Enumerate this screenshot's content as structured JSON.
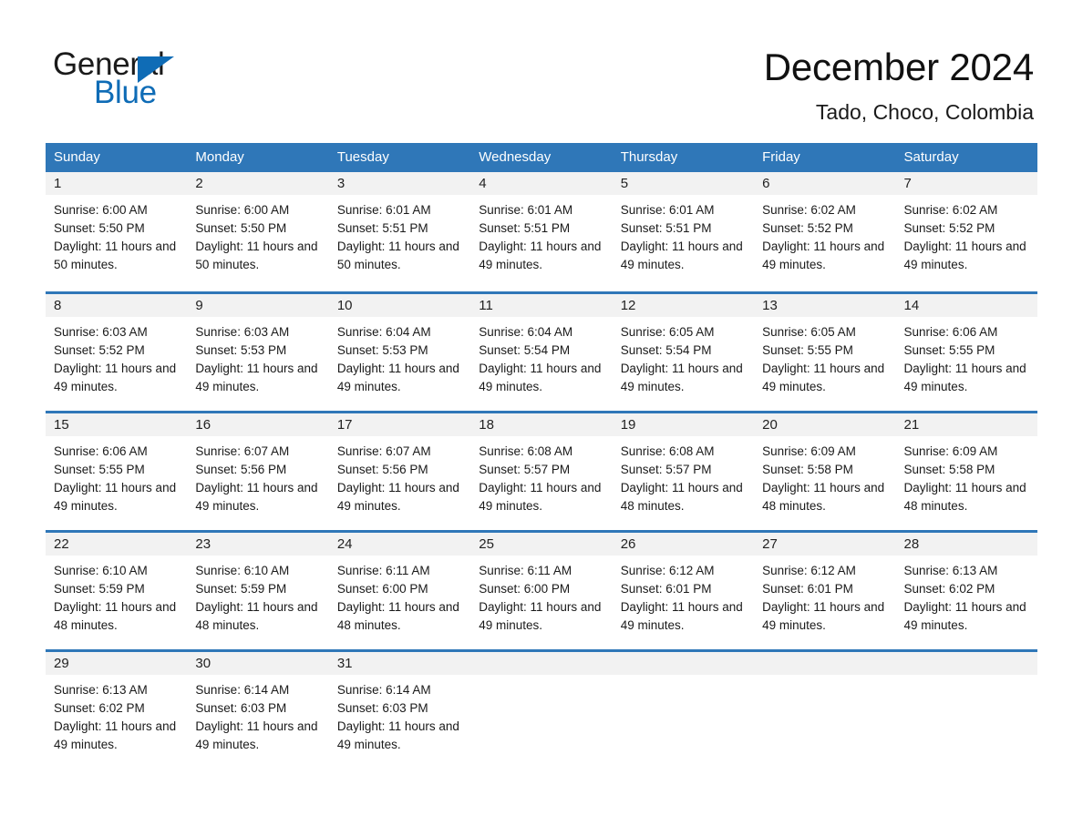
{
  "brand": {
    "name_part1": "General",
    "name_part2": "Blue",
    "triangle_icon": "brand-triangle-icon",
    "accent_color": "#0f6cb6"
  },
  "header": {
    "title": "December 2024",
    "subtitle": "Tado, Choco, Colombia"
  },
  "theme": {
    "header_blue": "#2f77b8",
    "day_bar_gray": "#f2f2f2",
    "text_dark": "#1a1a1a"
  },
  "weekdays": [
    "Sunday",
    "Monday",
    "Tuesday",
    "Wednesday",
    "Thursday",
    "Friday",
    "Saturday"
  ],
  "weeks": [
    [
      {
        "day": "1",
        "sunrise": "Sunrise: 6:00 AM",
        "sunset": "Sunset: 5:50 PM",
        "daylight": "Daylight: 11 hours and 50 minutes."
      },
      {
        "day": "2",
        "sunrise": "Sunrise: 6:00 AM",
        "sunset": "Sunset: 5:50 PM",
        "daylight": "Daylight: 11 hours and 50 minutes."
      },
      {
        "day": "3",
        "sunrise": "Sunrise: 6:01 AM",
        "sunset": "Sunset: 5:51 PM",
        "daylight": "Daylight: 11 hours and 50 minutes."
      },
      {
        "day": "4",
        "sunrise": "Sunrise: 6:01 AM",
        "sunset": "Sunset: 5:51 PM",
        "daylight": "Daylight: 11 hours and 49 minutes."
      },
      {
        "day": "5",
        "sunrise": "Sunrise: 6:01 AM",
        "sunset": "Sunset: 5:51 PM",
        "daylight": "Daylight: 11 hours and 49 minutes."
      },
      {
        "day": "6",
        "sunrise": "Sunrise: 6:02 AM",
        "sunset": "Sunset: 5:52 PM",
        "daylight": "Daylight: 11 hours and 49 minutes."
      },
      {
        "day": "7",
        "sunrise": "Sunrise: 6:02 AM",
        "sunset": "Sunset: 5:52 PM",
        "daylight": "Daylight: 11 hours and 49 minutes."
      }
    ],
    [
      {
        "day": "8",
        "sunrise": "Sunrise: 6:03 AM",
        "sunset": "Sunset: 5:52 PM",
        "daylight": "Daylight: 11 hours and 49 minutes."
      },
      {
        "day": "9",
        "sunrise": "Sunrise: 6:03 AM",
        "sunset": "Sunset: 5:53 PM",
        "daylight": "Daylight: 11 hours and 49 minutes."
      },
      {
        "day": "10",
        "sunrise": "Sunrise: 6:04 AM",
        "sunset": "Sunset: 5:53 PM",
        "daylight": "Daylight: 11 hours and 49 minutes."
      },
      {
        "day": "11",
        "sunrise": "Sunrise: 6:04 AM",
        "sunset": "Sunset: 5:54 PM",
        "daylight": "Daylight: 11 hours and 49 minutes."
      },
      {
        "day": "12",
        "sunrise": "Sunrise: 6:05 AM",
        "sunset": "Sunset: 5:54 PM",
        "daylight": "Daylight: 11 hours and 49 minutes."
      },
      {
        "day": "13",
        "sunrise": "Sunrise: 6:05 AM",
        "sunset": "Sunset: 5:55 PM",
        "daylight": "Daylight: 11 hours and 49 minutes."
      },
      {
        "day": "14",
        "sunrise": "Sunrise: 6:06 AM",
        "sunset": "Sunset: 5:55 PM",
        "daylight": "Daylight: 11 hours and 49 minutes."
      }
    ],
    [
      {
        "day": "15",
        "sunrise": "Sunrise: 6:06 AM",
        "sunset": "Sunset: 5:55 PM",
        "daylight": "Daylight: 11 hours and 49 minutes."
      },
      {
        "day": "16",
        "sunrise": "Sunrise: 6:07 AM",
        "sunset": "Sunset: 5:56 PM",
        "daylight": "Daylight: 11 hours and 49 minutes."
      },
      {
        "day": "17",
        "sunrise": "Sunrise: 6:07 AM",
        "sunset": "Sunset: 5:56 PM",
        "daylight": "Daylight: 11 hours and 49 minutes."
      },
      {
        "day": "18",
        "sunrise": "Sunrise: 6:08 AM",
        "sunset": "Sunset: 5:57 PM",
        "daylight": "Daylight: 11 hours and 49 minutes."
      },
      {
        "day": "19",
        "sunrise": "Sunrise: 6:08 AM",
        "sunset": "Sunset: 5:57 PM",
        "daylight": "Daylight: 11 hours and 48 minutes."
      },
      {
        "day": "20",
        "sunrise": "Sunrise: 6:09 AM",
        "sunset": "Sunset: 5:58 PM",
        "daylight": "Daylight: 11 hours and 48 minutes."
      },
      {
        "day": "21",
        "sunrise": "Sunrise: 6:09 AM",
        "sunset": "Sunset: 5:58 PM",
        "daylight": "Daylight: 11 hours and 48 minutes."
      }
    ],
    [
      {
        "day": "22",
        "sunrise": "Sunrise: 6:10 AM",
        "sunset": "Sunset: 5:59 PM",
        "daylight": "Daylight: 11 hours and 48 minutes."
      },
      {
        "day": "23",
        "sunrise": "Sunrise: 6:10 AM",
        "sunset": "Sunset: 5:59 PM",
        "daylight": "Daylight: 11 hours and 48 minutes."
      },
      {
        "day": "24",
        "sunrise": "Sunrise: 6:11 AM",
        "sunset": "Sunset: 6:00 PM",
        "daylight": "Daylight: 11 hours and 48 minutes."
      },
      {
        "day": "25",
        "sunrise": "Sunrise: 6:11 AM",
        "sunset": "Sunset: 6:00 PM",
        "daylight": "Daylight: 11 hours and 49 minutes."
      },
      {
        "day": "26",
        "sunrise": "Sunrise: 6:12 AM",
        "sunset": "Sunset: 6:01 PM",
        "daylight": "Daylight: 11 hours and 49 minutes."
      },
      {
        "day": "27",
        "sunrise": "Sunrise: 6:12 AM",
        "sunset": "Sunset: 6:01 PM",
        "daylight": "Daylight: 11 hours and 49 minutes."
      },
      {
        "day": "28",
        "sunrise": "Sunrise: 6:13 AM",
        "sunset": "Sunset: 6:02 PM",
        "daylight": "Daylight: 11 hours and 49 minutes."
      }
    ],
    [
      {
        "day": "29",
        "sunrise": "Sunrise: 6:13 AM",
        "sunset": "Sunset: 6:02 PM",
        "daylight": "Daylight: 11 hours and 49 minutes."
      },
      {
        "day": "30",
        "sunrise": "Sunrise: 6:14 AM",
        "sunset": "Sunset: 6:03 PM",
        "daylight": "Daylight: 11 hours and 49 minutes."
      },
      {
        "day": "31",
        "sunrise": "Sunrise: 6:14 AM",
        "sunset": "Sunset: 6:03 PM",
        "daylight": "Daylight: 11 hours and 49 minutes."
      },
      {
        "day": "",
        "sunrise": "",
        "sunset": "",
        "daylight": ""
      },
      {
        "day": "",
        "sunrise": "",
        "sunset": "",
        "daylight": ""
      },
      {
        "day": "",
        "sunrise": "",
        "sunset": "",
        "daylight": ""
      },
      {
        "day": "",
        "sunrise": "",
        "sunset": "",
        "daylight": ""
      }
    ]
  ]
}
